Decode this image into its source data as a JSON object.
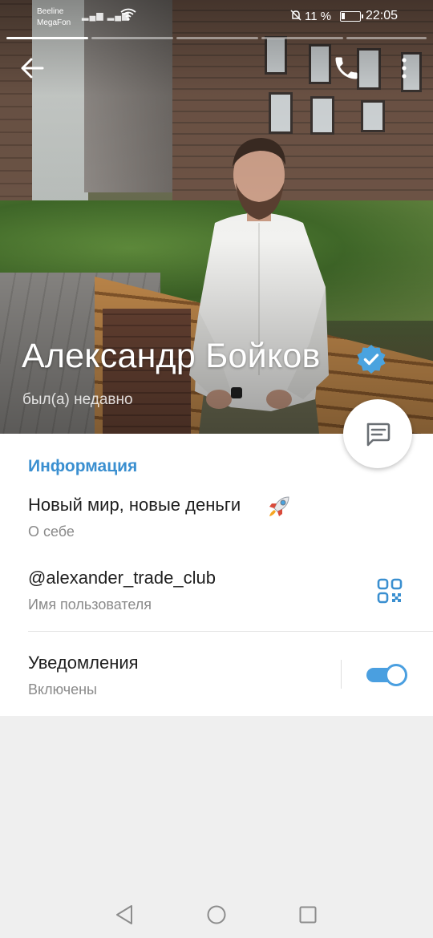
{
  "status_bar": {
    "carrier_1": "Beeline",
    "carrier_2": "MegaFon",
    "battery_percent": "11 %",
    "time": "22:05"
  },
  "profile": {
    "name": "Александр Бойков",
    "last_seen": "был(а) недавно",
    "verified": true
  },
  "info": {
    "section_title": "Информация",
    "bio": {
      "value": "Новый мир, новые деньги",
      "label": "О себе"
    },
    "username": {
      "value": "@alexander_trade_club",
      "label": "Имя пользователя"
    },
    "notifications": {
      "value": "Уведомления",
      "label": "Включены",
      "enabled": true
    }
  },
  "colors": {
    "accent": "#3a8fd0",
    "toggle_on": "#4a9fe0",
    "verified_badge": "#4aa3df",
    "background": "#efefef"
  },
  "icons": {
    "back": "arrow-left-icon",
    "call": "phone-icon",
    "more": "more-vertical-icon",
    "message": "message-icon",
    "qr": "qr-code-icon",
    "rocket": "rocket-icon",
    "verified": "verified-badge-icon"
  }
}
